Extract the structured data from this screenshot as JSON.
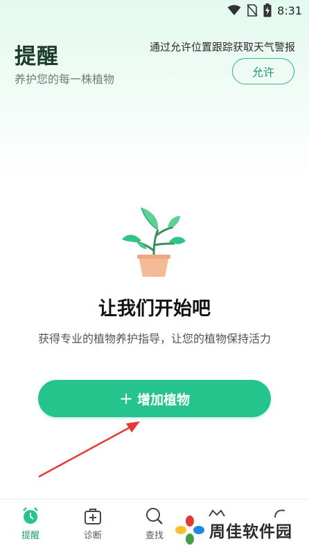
{
  "status_bar": {
    "time": "8:31",
    "icons": [
      "wifi-icon",
      "no-sim-icon",
      "battery-charging-icon"
    ]
  },
  "header": {
    "title": "提醒",
    "subtitle": "养护您的每一株植物",
    "location_prompt": "通过允许位置跟踪获取天气警报",
    "allow_label": "允许"
  },
  "empty_state": {
    "illustration": "potted-plant-icon",
    "title": "让我们开始吧",
    "description": "获得专业的植物养护指导，让您的植物保持活力"
  },
  "add_plant": {
    "icon": "plus-icon",
    "label": "增加植物"
  },
  "bottom_nav": {
    "items": [
      {
        "label": "提醒",
        "icon": "alarm-clock-icon",
        "active": true
      },
      {
        "label": "诊断",
        "icon": "medical-kit-icon",
        "active": false
      },
      {
        "label": "查找",
        "icon": "search-icon",
        "active": false
      },
      {
        "label": "",
        "icon": "plants-icon",
        "active": false
      },
      {
        "label": "",
        "icon": "profile-icon",
        "active": false
      }
    ]
  },
  "watermark": {
    "text": "周佳软件园"
  },
  "colors": {
    "accent": "#24c48c",
    "accent_dark": "#1f9b6d",
    "annotation_arrow": "#e53935"
  }
}
